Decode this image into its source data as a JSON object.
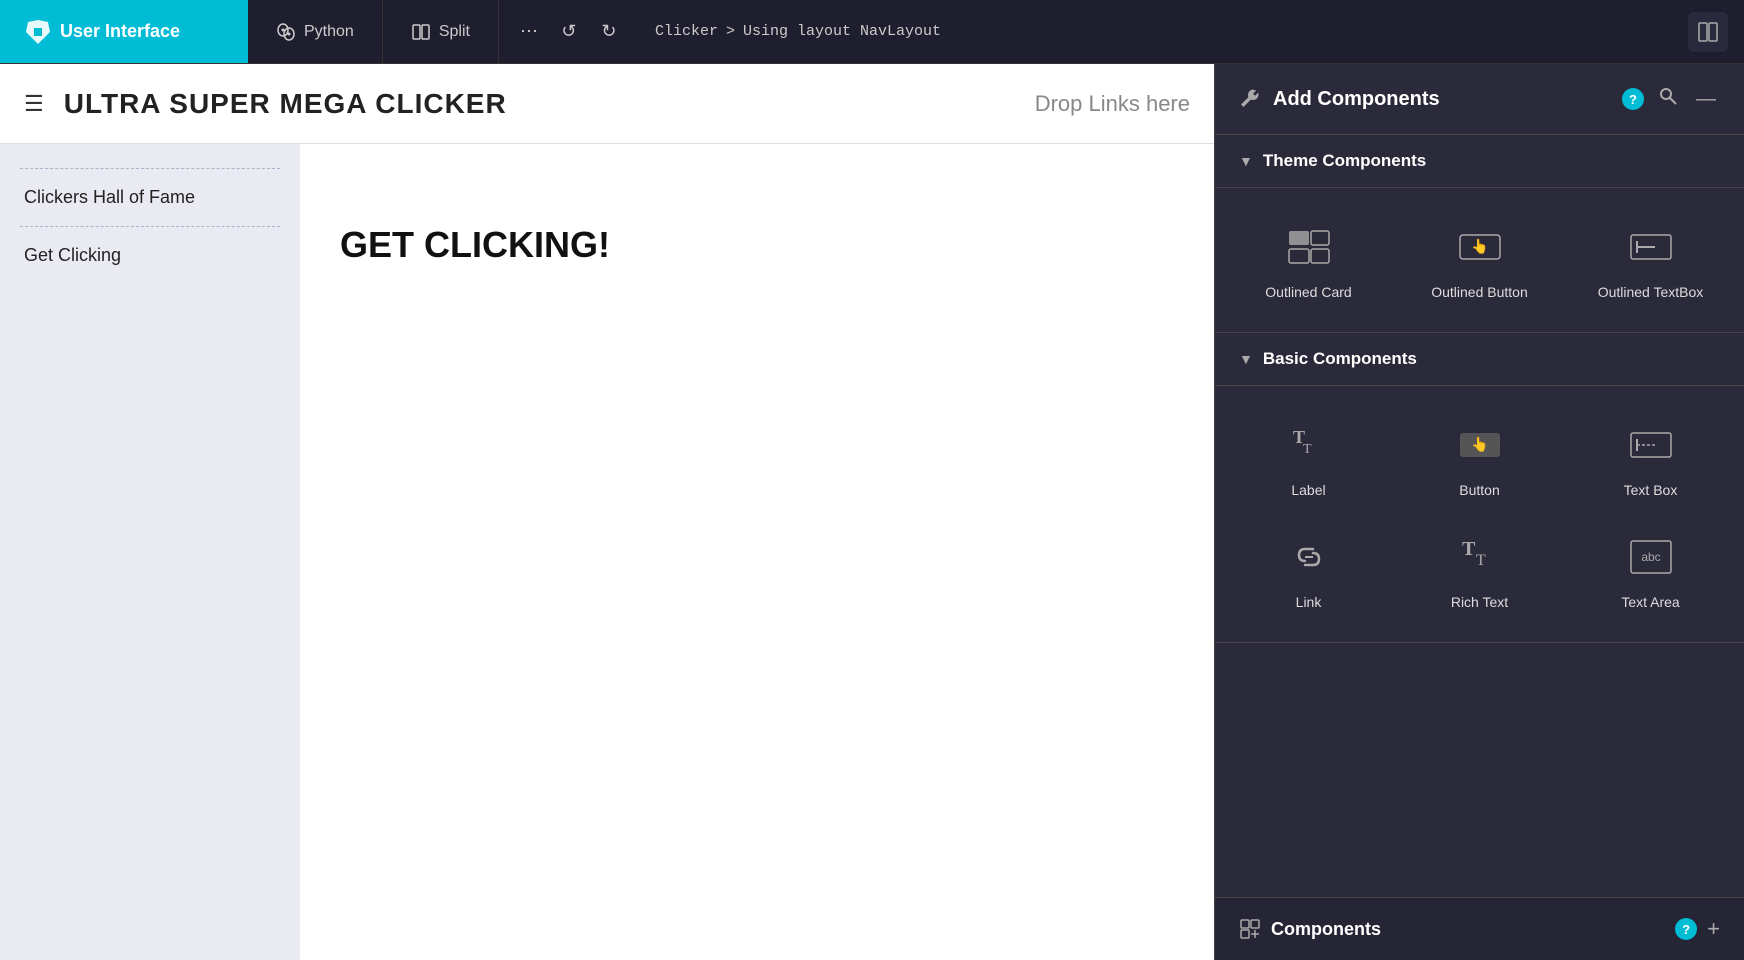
{
  "topbar": {
    "brand_label": "User Interface",
    "tabs": [
      {
        "label": "Python",
        "icon": "python"
      },
      {
        "label": "Split",
        "icon": "split"
      }
    ],
    "actions": [
      "⋯",
      "↺",
      "↻"
    ],
    "breadcrumb": {
      "app": "Clicker",
      "sep": ">",
      "path": "Using layout NavLayout"
    }
  },
  "app_header": {
    "hamburger": "☰",
    "title": "ULTRA SUPER MEGA CLICKER",
    "drop_links": "Drop Links here"
  },
  "sidebar": {
    "items": [
      {
        "label": "Clickers Hall of Fame"
      },
      {
        "label": "Get Clicking"
      }
    ]
  },
  "main": {
    "heading": "GET CLICKING!"
  },
  "right_panel": {
    "title": "Add Components",
    "help": "?",
    "sections": [
      {
        "label": "Theme Components",
        "components": [
          {
            "label": "Outlined Card",
            "icon": "card"
          },
          {
            "label": "Outlined Button",
            "icon": "outlined-button"
          },
          {
            "label": "Outlined TextBox",
            "icon": "outlined-textbox"
          }
        ]
      },
      {
        "label": "Basic Components",
        "components": [
          {
            "label": "Label",
            "icon": "label"
          },
          {
            "label": "Button",
            "icon": "button"
          },
          {
            "label": "Text Box",
            "icon": "textbox"
          },
          {
            "label": "Link",
            "icon": "link"
          },
          {
            "label": "Rich Text",
            "icon": "rich-text"
          },
          {
            "label": "Text Area",
            "icon": "textarea"
          }
        ]
      }
    ],
    "bottom": {
      "label": "Components",
      "help": "?",
      "add_icon": "+"
    }
  }
}
